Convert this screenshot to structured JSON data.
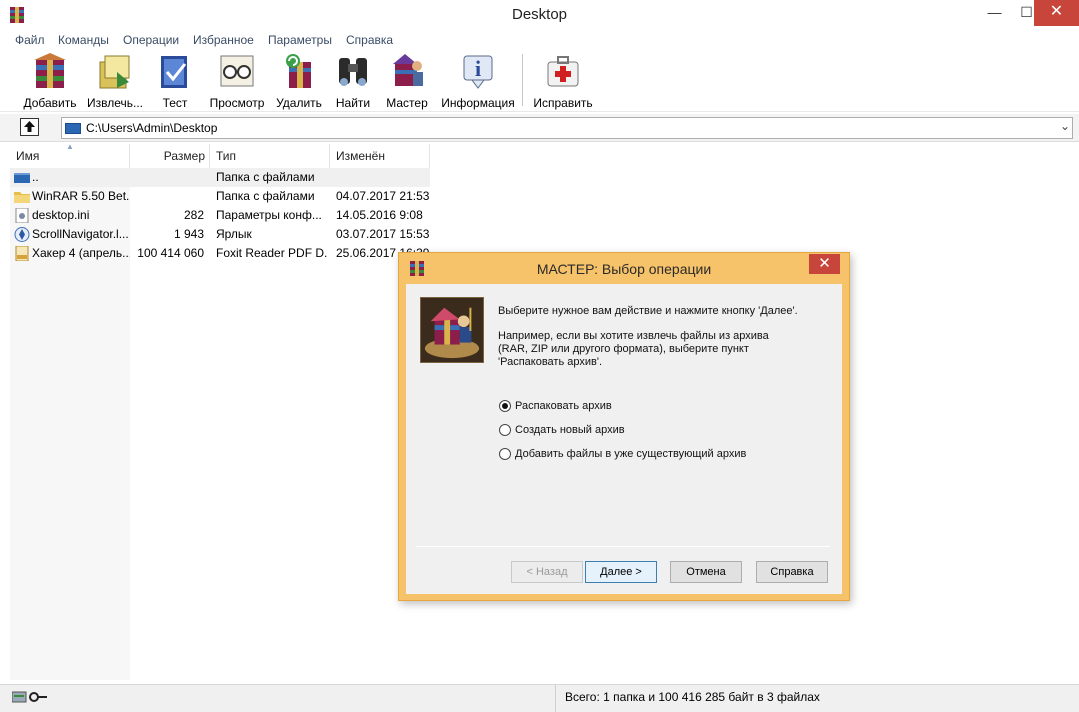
{
  "window": {
    "title": "Desktop",
    "min_glyph": "—",
    "max_glyph": "☐",
    "close_glyph": "✕"
  },
  "menu": [
    "Файл",
    "Команды",
    "Операции",
    "Избранное",
    "Параметры",
    "Справка"
  ],
  "toolbar": [
    {
      "label": "Добавить",
      "icon": "add-archive-icon"
    },
    {
      "label": "Извлечь...",
      "icon": "extract-icon"
    },
    {
      "label": "Тест",
      "icon": "test-icon"
    },
    {
      "label": "Просмотр",
      "icon": "view-icon"
    },
    {
      "label": "Удалить",
      "icon": "delete-icon"
    },
    {
      "label": "Найти",
      "icon": "find-icon"
    },
    {
      "label": "Мастер",
      "icon": "wizard-icon"
    },
    {
      "label": "Информация",
      "icon": "info-icon"
    },
    {
      "label": "Исправить",
      "icon": "repair-icon"
    }
  ],
  "address": {
    "path": "C:\\Users\\Admin\\Desktop",
    "dropdown_glyph": "⌄"
  },
  "columns": {
    "name": "Имя",
    "size": "Размер",
    "type": "Тип",
    "modified": "Изменён"
  },
  "files": [
    {
      "name": "..",
      "size": "",
      "type": "Папка с файлами",
      "modified": "",
      "icon": "parent-folder-icon"
    },
    {
      "name": "WinRAR 5.50 Bet...",
      "size": "",
      "type": "Папка с файлами",
      "modified": "04.07.2017 21:53",
      "icon": "folder-icon"
    },
    {
      "name": "desktop.ini",
      "size": "282",
      "type": "Параметры конф...",
      "modified": "14.05.2016 9:08",
      "icon": "settings-file-icon"
    },
    {
      "name": "ScrollNavigator.l...",
      "size": "1 943",
      "type": "Ярлык",
      "modified": "03.07.2017 15:53",
      "icon": "shortcut-icon"
    },
    {
      "name": "Хакер 4 (апрель...",
      "size": "100 414 060",
      "type": "Foxit Reader PDF D...",
      "modified": "25.06.2017 16:39",
      "icon": "pdf-icon"
    }
  ],
  "status": {
    "text": "Всего: 1 папка и 100 416 285 байт в 3 файлах"
  },
  "dialog": {
    "title": "МАСТЕР:  Выбор операции",
    "close_glyph": "✕",
    "intro": "Выберите нужное вам действие и нажмите кнопку 'Далее'.",
    "hint_line1": "Например, если вы хотите извлечь файлы из архива",
    "hint_line2": "(RAR, ZIP или другого формата), выберите пункт",
    "hint_line3": "'Распаковать архив'.",
    "options": [
      {
        "label": "Распаковать архив",
        "selected": true
      },
      {
        "label": "Создать новый архив",
        "selected": false
      },
      {
        "label": "Добавить файлы в уже существующий архив",
        "selected": false
      }
    ],
    "buttons": {
      "back": "< Назад",
      "next": "Далее >",
      "cancel": "Отмена",
      "help": "Справка"
    }
  }
}
